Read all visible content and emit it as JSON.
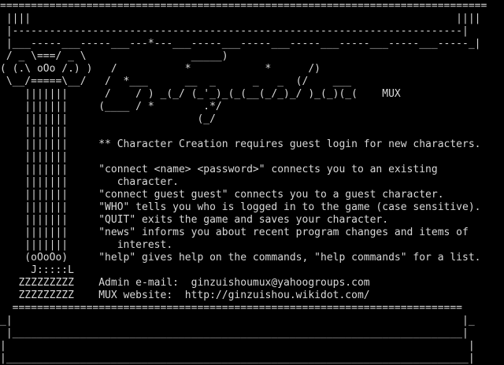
{
  "terminal": {
    "lines": [
      "===============================================================================",
      " ||||                                                                     ||||",
      " |-------------------------------------------------------------------------|",
      " |___-----___-----___---*---___-----___-----___-----___-----___-----___-----_|",
      " / _ \\===/ _ \\                 _____)",
      "( (.\\ oOo /.) )   /           *            *      /)",
      " \\__/=====\\__/   /  *___      __  _      _   _  (/    ___",
      "    |||||||      /    / ) _(_/ (_'_)_(_(__(_/_)_/ )_(_)(_(    MUX",
      "    |||||||     (____ / *        .*/",
      "    |||||||                     (_/",
      "    |||||||",
      "    |||||||     ** Character Creation requires guest login for new characters.",
      "    |||||||",
      "    |||||||     \"connect <name> <password>\" connects you to an existing",
      "    |||||||        character.",
      "    |||||||     \"connect guest guest\" connects you to a guest character.",
      "    |||||||     \"WHO\" tells you who is logged in to the game (case sensitive).",
      "    |||||||     \"QUIT\" exits the game and saves your character.",
      "    |||||||     \"news\" informs you about recent program changes and items of",
      "    |||||||        interest.",
      "    (oOoOo)     \"help\" gives help on the commands, \"help commands\" for a list.",
      "     J:::::L",
      "   ZZZZZZZZZ    Admin e-mail:  ginzuishoumux@yahoogroups.com",
      "   ZZZZZZZZZ    MUX website:  http://ginzuishou.wikidot.com/",
      "  =========================================================================",
      "_|                                                                         |_",
      " |_________________________________________________________________________|",
      "|                                                                           |",
      "|___________________________________________________________________________|"
    ]
  }
}
